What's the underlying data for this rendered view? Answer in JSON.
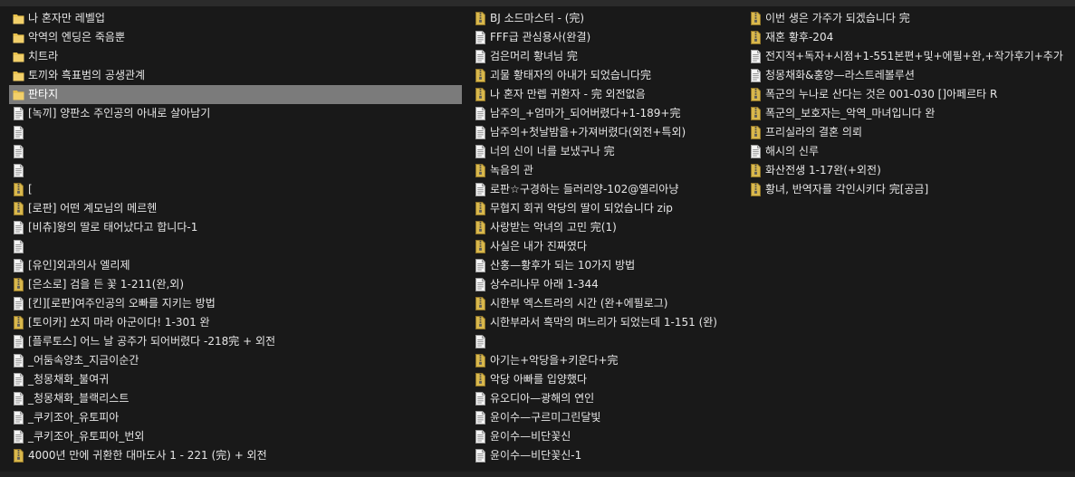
{
  "columns": [
    {
      "items": [
        {
          "name": "나 혼자만 레벨업",
          "icon": "folder-icon"
        },
        {
          "name": "악역의 엔딩은 죽음뿐",
          "icon": "folder-icon"
        },
        {
          "name": "치트라",
          "icon": "folder-icon"
        },
        {
          "name": "토끼와 흑표범의 공생관계",
          "icon": "folder-icon"
        },
        {
          "name": "판타지",
          "icon": "folder-icon",
          "selected": true
        },
        {
          "name": "[녹끼] 양판소 주인공의 아내로 살아남기",
          "icon": "text-file-icon"
        },
        {
          "name": "",
          "icon": "text-file-icon"
        },
        {
          "name": "",
          "icon": "text-file-icon"
        },
        {
          "name": "",
          "icon": "text-file-icon"
        },
        {
          "name": "[",
          "icon": "zip-file-icon"
        },
        {
          "name": "[로판] 어떤 계모님의 메르헨",
          "icon": "zip-file-icon"
        },
        {
          "name": "[비츄]왕의 딸로 태어났다고 합니다-1",
          "icon": "text-file-icon"
        },
        {
          "name": "",
          "icon": "text-file-icon"
        },
        {
          "name": "[유인]외과의사 엘리제",
          "icon": "text-file-icon"
        },
        {
          "name": "[은소로] 검을 든 꽃 1-211(완,외)",
          "icon": "zip-file-icon"
        },
        {
          "name": "[킨][로판]여주인공의 오빠를 지키는 방법",
          "icon": "text-file-icon"
        },
        {
          "name": "[토이카] 쏘지 마라 아군이다! 1-301 완",
          "icon": "zip-file-icon"
        },
        {
          "name": "[플루토스] 어느 날 공주가 되어버렸다 -218完 + 외전",
          "icon": "text-file-icon"
        },
        {
          "name": "_어둠속양초_지금이순간",
          "icon": "text-file-icon"
        },
        {
          "name": "_청몽채화_불여귀",
          "icon": "text-file-icon"
        },
        {
          "name": "_청몽채화_블랙리스트",
          "icon": "text-file-icon"
        },
        {
          "name": "_쿠키조아_유토피아",
          "icon": "text-file-icon"
        },
        {
          "name": "_쿠키조아_유토피아_번외",
          "icon": "text-file-icon"
        },
        {
          "name": "4000년 만에 귀환한 대마도사  1 - 221  (完) + 외전",
          "icon": "zip-file-icon"
        }
      ]
    },
    {
      "items": [
        {
          "name": "BJ 소드마스터 - (完)",
          "icon": "zip-file-icon"
        },
        {
          "name": "FFF급 관심용사(완결)",
          "icon": "text-file-icon"
        },
        {
          "name": "검은머리 황녀님 完",
          "icon": "text-file-icon"
        },
        {
          "name": "괴물 황태자의 아내가 되었습니다完",
          "icon": "zip-file-icon"
        },
        {
          "name": "나 혼자 만렙 귀환자 -  完 외전없음",
          "icon": "zip-file-icon"
        },
        {
          "name": "남주의_+엄마가_되어버렸다+1-189+完",
          "icon": "text-file-icon"
        },
        {
          "name": "남주의+첫날밤을+가져버렸다(외전+특외)",
          "icon": "text-file-icon"
        },
        {
          "name": "너의 신이 너를 보냈구나 完",
          "icon": "text-file-icon"
        },
        {
          "name": "녹음의 관",
          "icon": "zip-file-icon"
        },
        {
          "name": "로판☆구경하는 들러리양-102@엘리아냥",
          "icon": "text-file-icon"
        },
        {
          "name": "무협지 회귀 악당의 딸이 되었습니다 zip",
          "icon": "zip-file-icon"
        },
        {
          "name": "사랑받는 악녀의 고민 完(1)",
          "icon": "zip-file-icon"
        },
        {
          "name": "사실은 내가 진짜였다",
          "icon": "zip-file-icon"
        },
        {
          "name": "산홍—황후가 되는 10가지 방법",
          "icon": "text-file-icon"
        },
        {
          "name": "상수리나무 아래 1-344",
          "icon": "text-file-icon"
        },
        {
          "name": "시한부 엑스트라의 시간 (완+에필로그)",
          "icon": "zip-file-icon"
        },
        {
          "name": "시한부라서 흑막의 며느리가 되었는데 1-151 (완)",
          "icon": "zip-file-icon"
        },
        {
          "name": "",
          "icon": "text-file-icon"
        },
        {
          "name": "아기는+악당을+키운다+完",
          "icon": "zip-file-icon"
        },
        {
          "name": "악당 아빠를 입양했다",
          "icon": "zip-file-icon"
        },
        {
          "name": "유오디아—광해의 연인",
          "icon": "text-file-icon"
        },
        {
          "name": "윤이수—구르미그린달빛",
          "icon": "text-file-icon"
        },
        {
          "name": "윤이수—비단꽃신",
          "icon": "text-file-icon"
        },
        {
          "name": "윤이수—비단꽃신-1",
          "icon": "text-file-icon"
        }
      ]
    },
    {
      "items": [
        {
          "name": "이번 생은 가주가 되겠습니다 完",
          "icon": "zip-file-icon"
        },
        {
          "name": "재혼 황후-204",
          "icon": "zip-file-icon"
        },
        {
          "name": "전지적+독자+시점+1-551본편+및+에필+완,+작가후기+추가",
          "icon": "text-file-icon"
        },
        {
          "name": "청몽채화&홍양—라스트레볼루션",
          "icon": "text-file-icon"
        },
        {
          "name": "폭군의 누나로 산다는 것은 001-030 []아페르타 R",
          "icon": "zip-file-icon"
        },
        {
          "name": "폭군의_보호자는_악역_마녀입니다 완",
          "icon": "zip-file-icon"
        },
        {
          "name": "프리실라의 결혼 의뢰",
          "icon": "zip-file-icon"
        },
        {
          "name": "해시의 신루",
          "icon": "text-file-icon"
        },
        {
          "name": "화산전생 1-17완(+외전)",
          "icon": "zip-file-icon"
        },
        {
          "name": "황녀, 반역자를 각인시키다 完[공금]",
          "icon": "zip-file-icon"
        }
      ]
    }
  ],
  "colors": {
    "background": "#191919",
    "text": "#e6e6e6",
    "selection": "#7b7b7b",
    "folder": "#e8c04a",
    "zip": "#d9b84c"
  }
}
